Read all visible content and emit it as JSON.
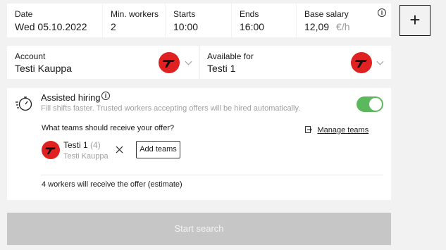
{
  "top_fields": {
    "date": {
      "label": "Date",
      "value": "Wed 05.10.2022"
    },
    "min_workers": {
      "label": "Min. workers",
      "value": "2"
    },
    "starts": {
      "label": "Starts",
      "value": "10:00"
    },
    "ends": {
      "label": "Ends",
      "value": "16:00"
    },
    "base_salary": {
      "label": "Base salary",
      "value": "12,09",
      "unit": "€/h"
    }
  },
  "add_button": {
    "label": "+"
  },
  "account": {
    "label": "Account",
    "value": "Testi Kauppa"
  },
  "available_for": {
    "label": "Available for",
    "value": "Testi 1"
  },
  "assisted_hiring": {
    "title": "Assisted hiring",
    "description": "Fill shifts faster. Trusted workers accepting offers will be hired automatically.",
    "toggle_on": true,
    "teams_question": "What teams should receive your offer?",
    "manage_teams_label": "Manage teams",
    "team": {
      "name": "Testi 1",
      "count": "(4)",
      "org": "Testi Kauppa"
    },
    "add_teams_label": "Add teams",
    "estimate": "4 workers will receive the offer (estimate)"
  },
  "start_search_label": "Start search",
  "colors": {
    "brand_red": "#e02121",
    "toggle_green": "#5cb85c",
    "disabled_button": "#c6c6c6"
  },
  "icons": [
    "info-icon",
    "plus-icon",
    "brand-logo-icon",
    "chevron-down-icon",
    "stopwatch-icon",
    "external-link-icon",
    "close-icon"
  ]
}
